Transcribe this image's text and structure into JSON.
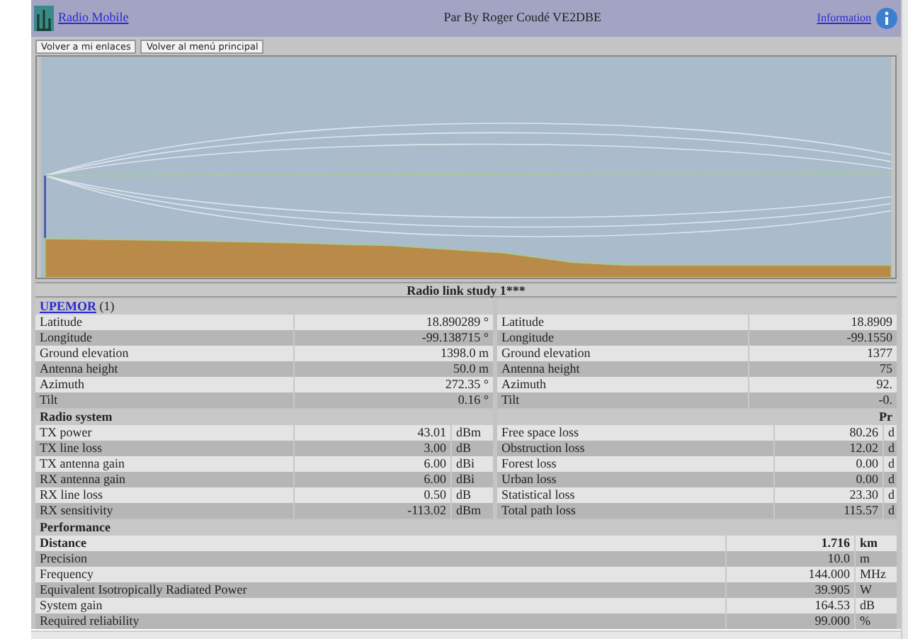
{
  "header": {
    "app_link": "Radio Mobile",
    "author": "Par By Roger Coudé VE2DBE",
    "info_link": "Information"
  },
  "buttons": [
    "Volver a mi enlaces",
    "Volver al menú principal"
  ],
  "study_title": "Radio link study 1***",
  "unit_a": {
    "name": "UPEMOR",
    "suffix": "(1)",
    "rows": [
      {
        "label": "Latitude",
        "value": "18.890289 °"
      },
      {
        "label": "Longitude",
        "value": "-99.138715 °"
      },
      {
        "label": "Ground elevation",
        "value": "1398.0 m"
      },
      {
        "label": "Antenna height",
        "value": "50.0 m"
      },
      {
        "label": "Azimuth",
        "value": "272.35 °"
      },
      {
        "label": "Tilt",
        "value": "0.16 °"
      }
    ]
  },
  "unit_b": {
    "rows": [
      {
        "label": "Latitude",
        "value": "18.8909"
      },
      {
        "label": "Longitude",
        "value": "-99.1550"
      },
      {
        "label": "Ground elevation",
        "value": "1377"
      },
      {
        "label": "Antenna height",
        "value": "75"
      },
      {
        "label": "Azimuth",
        "value": "92."
      },
      {
        "label": "Tilt",
        "value": "-0."
      }
    ]
  },
  "radio_system": {
    "title": "Radio system",
    "rows": [
      {
        "label": "TX power",
        "value": "43.01",
        "unit": "dBm"
      },
      {
        "label": "TX line loss",
        "value": "3.00",
        "unit": "dB"
      },
      {
        "label": "TX antenna gain",
        "value": "6.00",
        "unit": "dBi"
      },
      {
        "label": "RX antenna gain",
        "value": "6.00",
        "unit": "dBi"
      },
      {
        "label": "RX line loss",
        "value": "0.50",
        "unit": "dB"
      },
      {
        "label": "RX sensitivity",
        "value": "-113.02",
        "unit": "dBm"
      }
    ]
  },
  "propagation": {
    "title": "Pr",
    "rows": [
      {
        "label": "Free space loss",
        "value": "80.26",
        "unit": "d"
      },
      {
        "label": "Obstruction loss",
        "value": "12.02",
        "unit": "d"
      },
      {
        "label": "Forest loss",
        "value": "0.00",
        "unit": "d"
      },
      {
        "label": "Urban loss",
        "value": "0.00",
        "unit": "d"
      },
      {
        "label": "Statistical loss",
        "value": "23.30",
        "unit": "d"
      },
      {
        "label": "Total path loss",
        "value": "115.57",
        "unit": "d"
      }
    ]
  },
  "performance": {
    "title": "Performance",
    "rows": [
      {
        "label": "Distance",
        "value": "1.716",
        "unit": "km",
        "bold": true
      },
      {
        "label": "Precision",
        "value": "10.0",
        "unit": "m",
        "bold": false
      },
      {
        "label": "Frequency",
        "value": "144.000",
        "unit": "MHz",
        "bold": false
      },
      {
        "label": "Equivalent Isotropically Radiated Power",
        "value": "39.905",
        "unit": "W",
        "bold": false
      },
      {
        "label": "System gain",
        "value": "164.53",
        "unit": "dB",
        "bold": false
      },
      {
        "label": "Required reliability",
        "value": "99.000",
        "unit": "%",
        "bold": false
      }
    ]
  }
}
